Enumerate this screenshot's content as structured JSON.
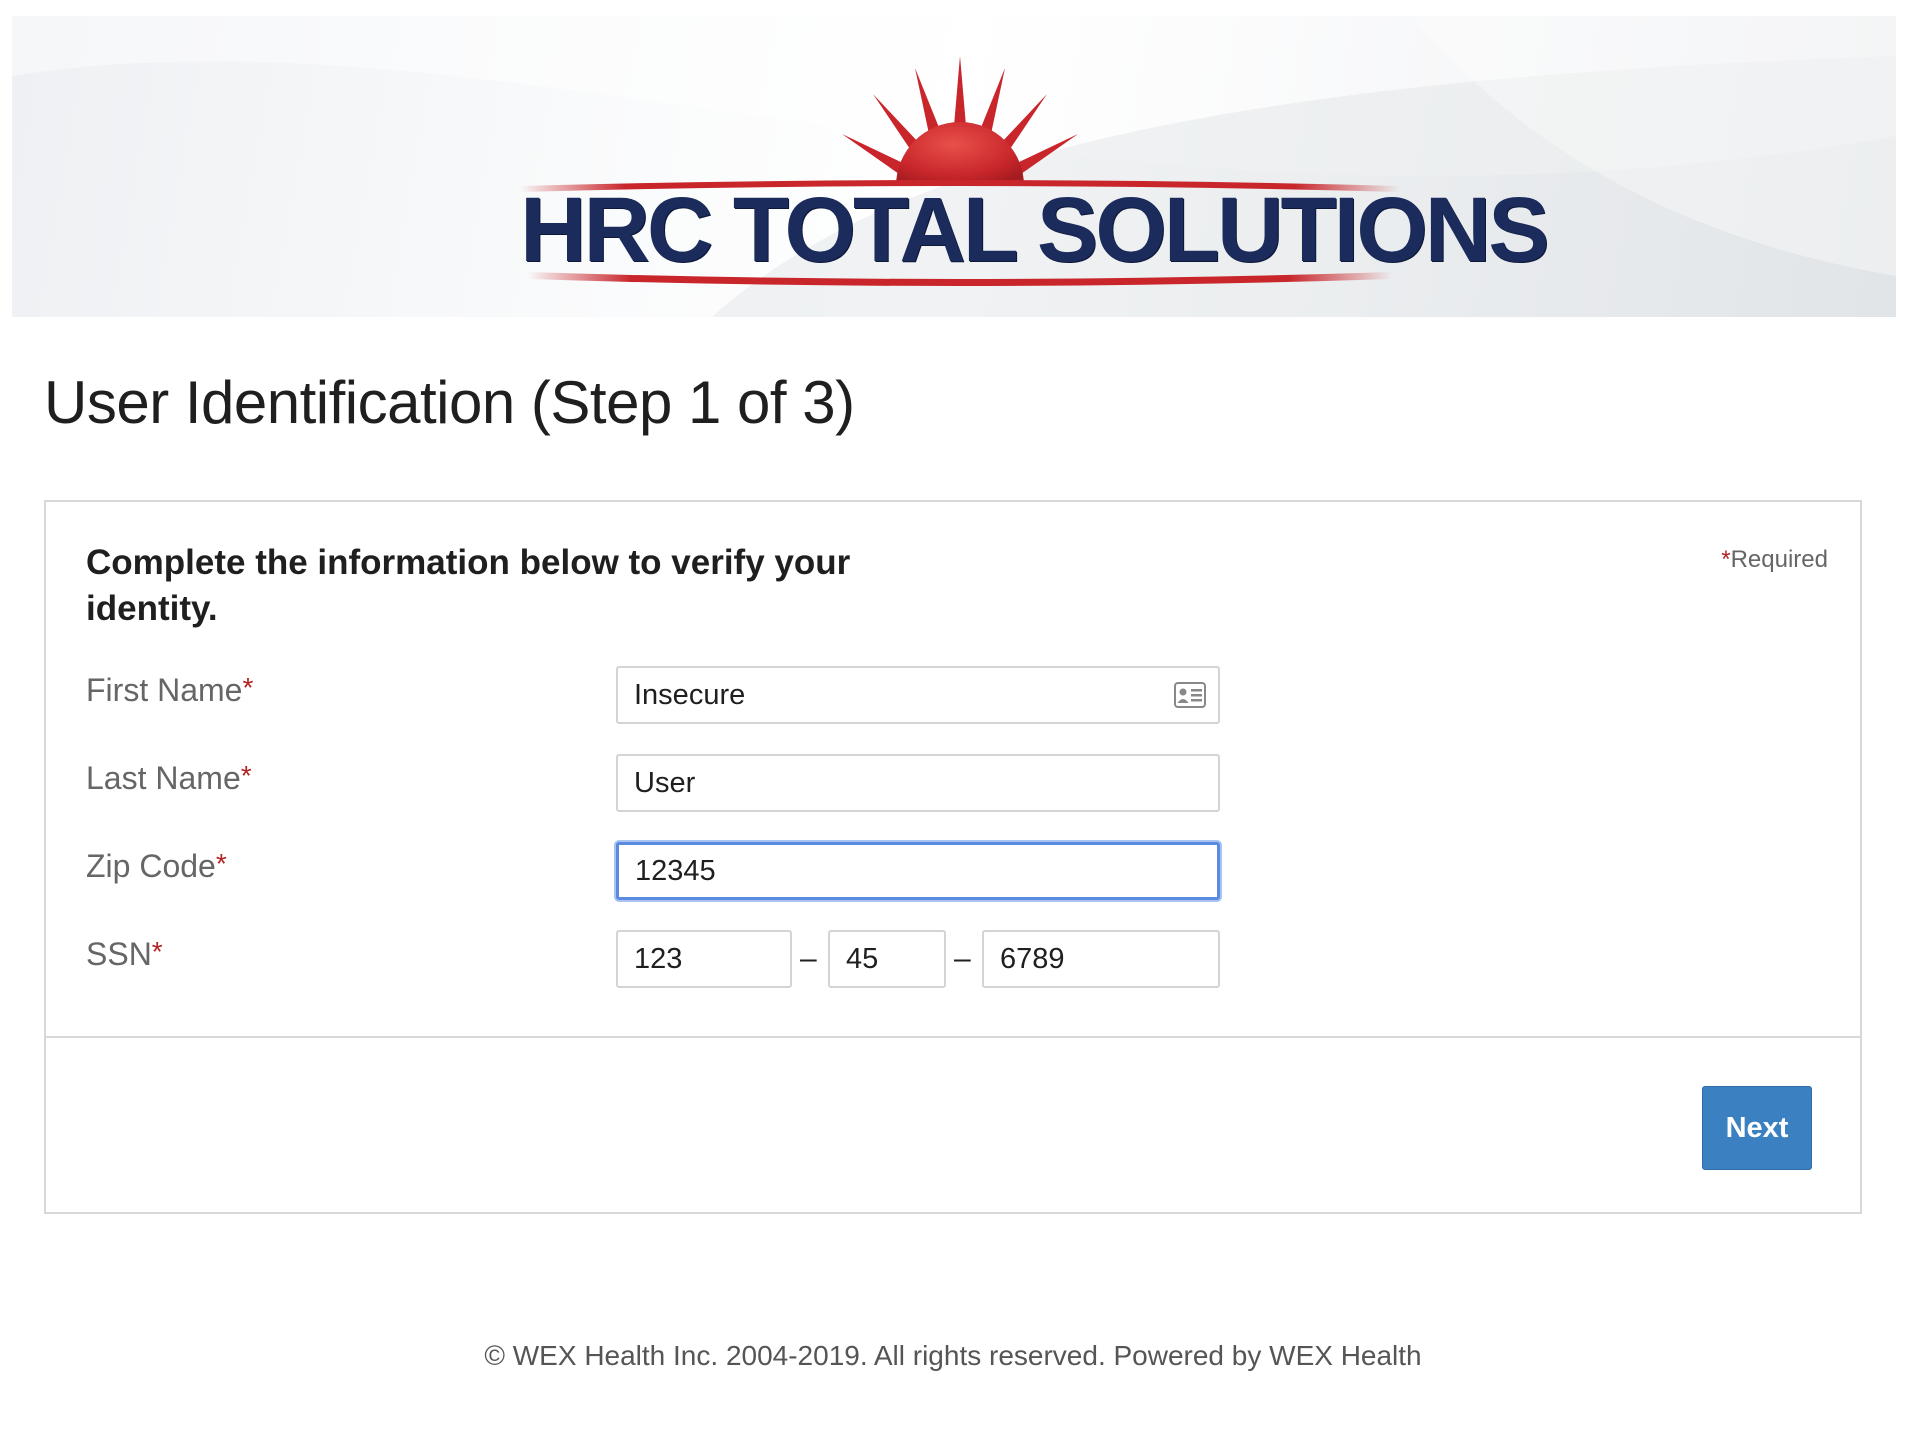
{
  "header": {
    "logo_text": "HRC TOTAL SOLUTIONS",
    "logo_colors": {
      "navy": "#1a2b5c",
      "red": "#c8262b"
    }
  },
  "page": {
    "title": "User Identification (Step 1 of 3)"
  },
  "form": {
    "instructions": "Complete the information below to verify your identity.",
    "required_note_star": "*",
    "required_note_text": "Required",
    "required_star": "*",
    "fields": {
      "first_name": {
        "label": "First Name",
        "value": "Insecure",
        "icon": "id-card-icon"
      },
      "last_name": {
        "label": "Last Name",
        "value": "User"
      },
      "zip_code": {
        "label": "Zip Code",
        "value": "12345",
        "focused": true
      },
      "ssn": {
        "label": "SSN",
        "part1": "123",
        "part2": "45",
        "part3": "6789",
        "separator": "–"
      }
    },
    "next_label": "Next",
    "accent_color": "#3b80c0",
    "focus_color": "#5b8be0",
    "required_color": "#b22222"
  },
  "footer": {
    "text": "© WEX Health Inc. 2004-2019. All rights reserved. Powered by WEX Health"
  }
}
